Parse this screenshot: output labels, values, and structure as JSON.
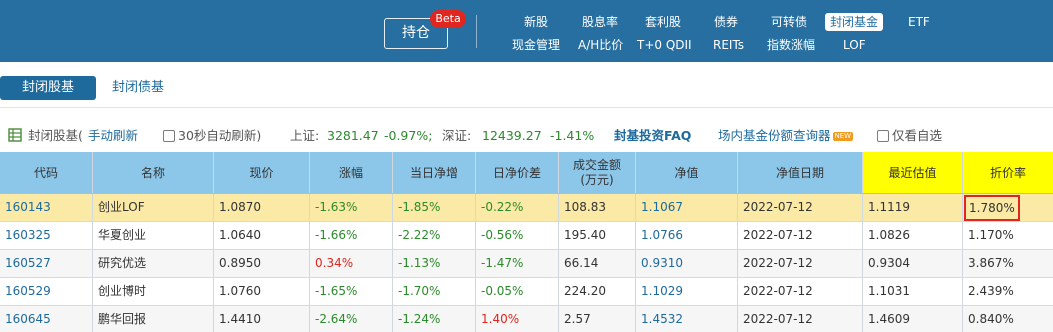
{
  "nav": {
    "hold_button": "持仓",
    "beta_badge": "Beta",
    "row1": [
      "新股",
      "股息率",
      "套利股",
      "债券",
      "可转债",
      "封闭基金",
      "ETF"
    ],
    "row2": [
      "现金管理",
      "A/H比价",
      "T+0 QDII",
      "REITs",
      "指数涨幅",
      "LOF"
    ],
    "active": "封闭基金"
  },
  "tabs": {
    "active": "封闭股基",
    "other": "封闭债基"
  },
  "filter": {
    "section": "封闭股基(",
    "manual_refresh": "手动刷新",
    "auto_refresh": "30秒自动刷新)",
    "sh_label": "上证:",
    "sh_value": "3281.47",
    "sh_change": "-0.97%;",
    "sz_label": "深证:",
    "sz_value": "12439.27",
    "sz_change": "-1.41%",
    "faq": "封基投资FAQ",
    "query_tool": "场内基金份额查询器",
    "new_badge": "NEW",
    "watchlist": "仅看自选"
  },
  "table": {
    "headers": {
      "code": "代码",
      "name": "名称",
      "price": "现价",
      "change": "涨幅",
      "nav_change": "当日净增",
      "nav_diff": "日净价差",
      "amount_l1": "成交金额",
      "amount_l2": "(万元)",
      "nav": "净值",
      "nav_date": "净值日期",
      "est": "最近估值",
      "discount": "折价率"
    },
    "rows": [
      {
        "code": "160143",
        "name": "创业LOF",
        "price": "1.0870",
        "change": "-1.63%",
        "nav_change": "-1.85%",
        "nav_diff": "-0.22%",
        "amount": "108.83",
        "nav": "1.1067",
        "date": "2022-07-12",
        "est": "1.1119",
        "discount": "1.780%"
      },
      {
        "code": "160325",
        "name": "华夏创业",
        "price": "1.0640",
        "change": "-1.66%",
        "nav_change": "-2.22%",
        "nav_diff": "-0.56%",
        "amount": "195.40",
        "nav": "1.0766",
        "date": "2022-07-12",
        "est": "1.0826",
        "discount": "1.170%"
      },
      {
        "code": "160527",
        "name": "研究优选",
        "price": "0.8950",
        "change": "0.34%",
        "nav_change": "-1.13%",
        "nav_diff": "-1.47%",
        "amount": "66.14",
        "nav": "0.9310",
        "date": "2022-07-12",
        "est": "0.9304",
        "discount": "3.867%"
      },
      {
        "code": "160529",
        "name": "创业博时",
        "price": "1.0760",
        "change": "-1.65%",
        "nav_change": "-1.70%",
        "nav_diff": "-0.05%",
        "amount": "224.20",
        "nav": "1.1029",
        "date": "2022-07-12",
        "est": "1.1031",
        "discount": "2.439%"
      },
      {
        "code": "160645",
        "name": "鹏华回报",
        "price": "1.4410",
        "change": "-2.64%",
        "nav_change": "-1.24%",
        "nav_diff": "1.40%",
        "amount": "2.57",
        "nav": "1.4532",
        "date": "2022-07-12",
        "est": "1.4609",
        "discount": "0.840%"
      }
    ]
  },
  "colors": {
    "nav_bg": "#266fa0",
    "header_bg": "#8cc7ea",
    "highlight_row": "#fbe9a6",
    "estimate_header": "#ffff00",
    "negative": "#2c8a2c",
    "positive": "#e0261f"
  }
}
